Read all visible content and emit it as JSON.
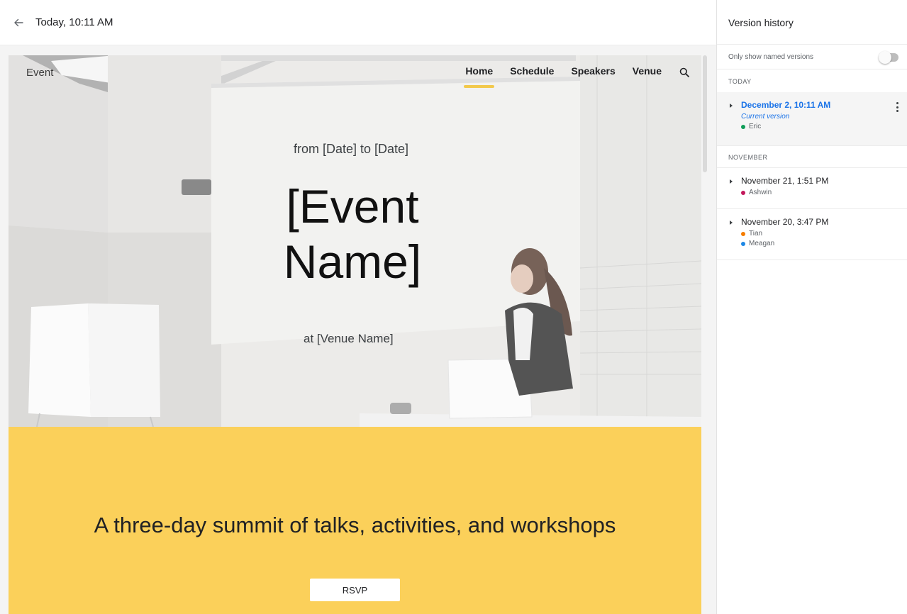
{
  "topbar": {
    "back_icon": "arrow-left-icon",
    "title": "Today, 10:11 AM"
  },
  "site": {
    "brand": "Event",
    "nav": [
      {
        "label": "Home",
        "active": true
      },
      {
        "label": "Schedule",
        "active": false
      },
      {
        "label": "Speakers",
        "active": false
      },
      {
        "label": "Venue",
        "active": false
      }
    ],
    "search_icon": "search-icon",
    "hero": {
      "dates": "from [Date] to [Date]",
      "title_line1": "[Event",
      "title_line2": "Name]",
      "venue": "at [Venue Name]"
    },
    "band": {
      "tagline": "A three-day summit of talks, activities, and workshops",
      "rsvp_label": "RSVP",
      "color": "#fbd05a"
    },
    "accent_color": "#f2c94c"
  },
  "panel": {
    "title": "Version history",
    "filter_label": "Only show named versions",
    "filter_on": false,
    "sections": [
      {
        "label": "TODAY",
        "versions": [
          {
            "date": "December 2, 10:11 AM",
            "subtitle": "Current version",
            "current": true,
            "authors": [
              {
                "name": "Eric",
                "color": "#0f9d58"
              }
            ]
          }
        ]
      },
      {
        "label": "NOVEMBER",
        "versions": [
          {
            "date": "November 21, 1:51 PM",
            "current": false,
            "authors": [
              {
                "name": "Ashwin",
                "color": "#c2185b"
              }
            ]
          },
          {
            "date": "November 20, 3:47 PM",
            "current": false,
            "authors": [
              {
                "name": "Tian",
                "color": "#f57c00"
              },
              {
                "name": "Meagan",
                "color": "#1e88e5"
              }
            ]
          }
        ]
      }
    ],
    "link_color": "#1a73e8"
  }
}
